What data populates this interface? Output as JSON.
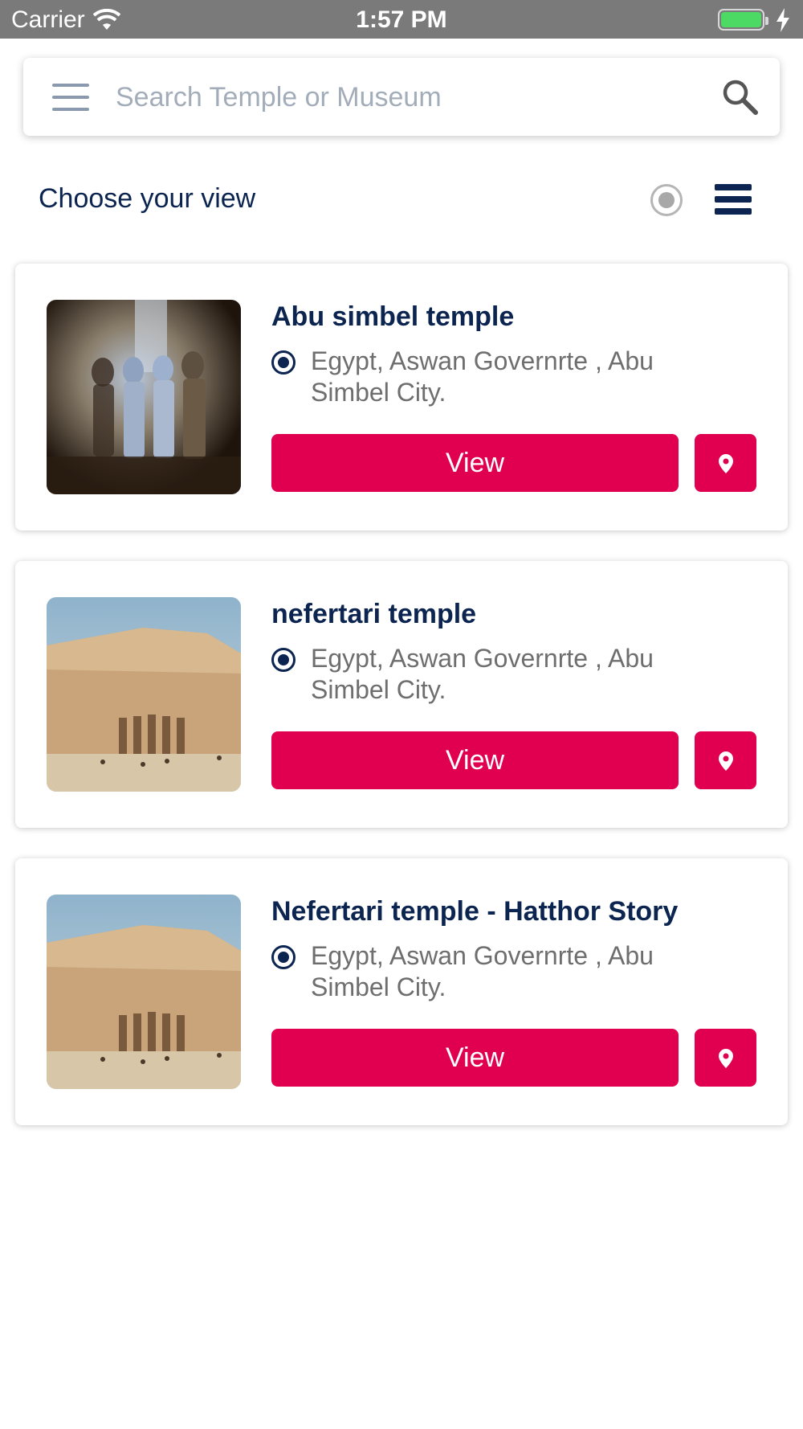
{
  "status_bar": {
    "carrier": "Carrier",
    "time": "1:57 PM",
    "battery_color": "#4cd964"
  },
  "search": {
    "placeholder": "Search Temple or Museum",
    "value": "",
    "menu_icon": "hamburger-menu-icon",
    "search_icon": "magnifier-icon"
  },
  "view_selector": {
    "label": "Choose your view",
    "options": [
      "grid-radio-icon",
      "list-view-icon"
    ]
  },
  "colors": {
    "accent": "#e0004f",
    "title": "#0b2450",
    "muted": "#6e6e6e"
  },
  "places": [
    {
      "title": "Abu simbel temple",
      "location": "Egypt, Aswan Governrte , Abu Simbel City.",
      "view_label": "View",
      "image": "statues-lit-photo"
    },
    {
      "title": "nefertari temple",
      "location": "Egypt, Aswan Governrte , Abu Simbel City.",
      "view_label": "View",
      "image": "temple-facade-photo"
    },
    {
      "title": "Nefertari temple - Hatthor Story",
      "location": "Egypt, Aswan Governrte , Abu Simbel City.",
      "view_label": "View",
      "image": "temple-facade-photo"
    }
  ]
}
